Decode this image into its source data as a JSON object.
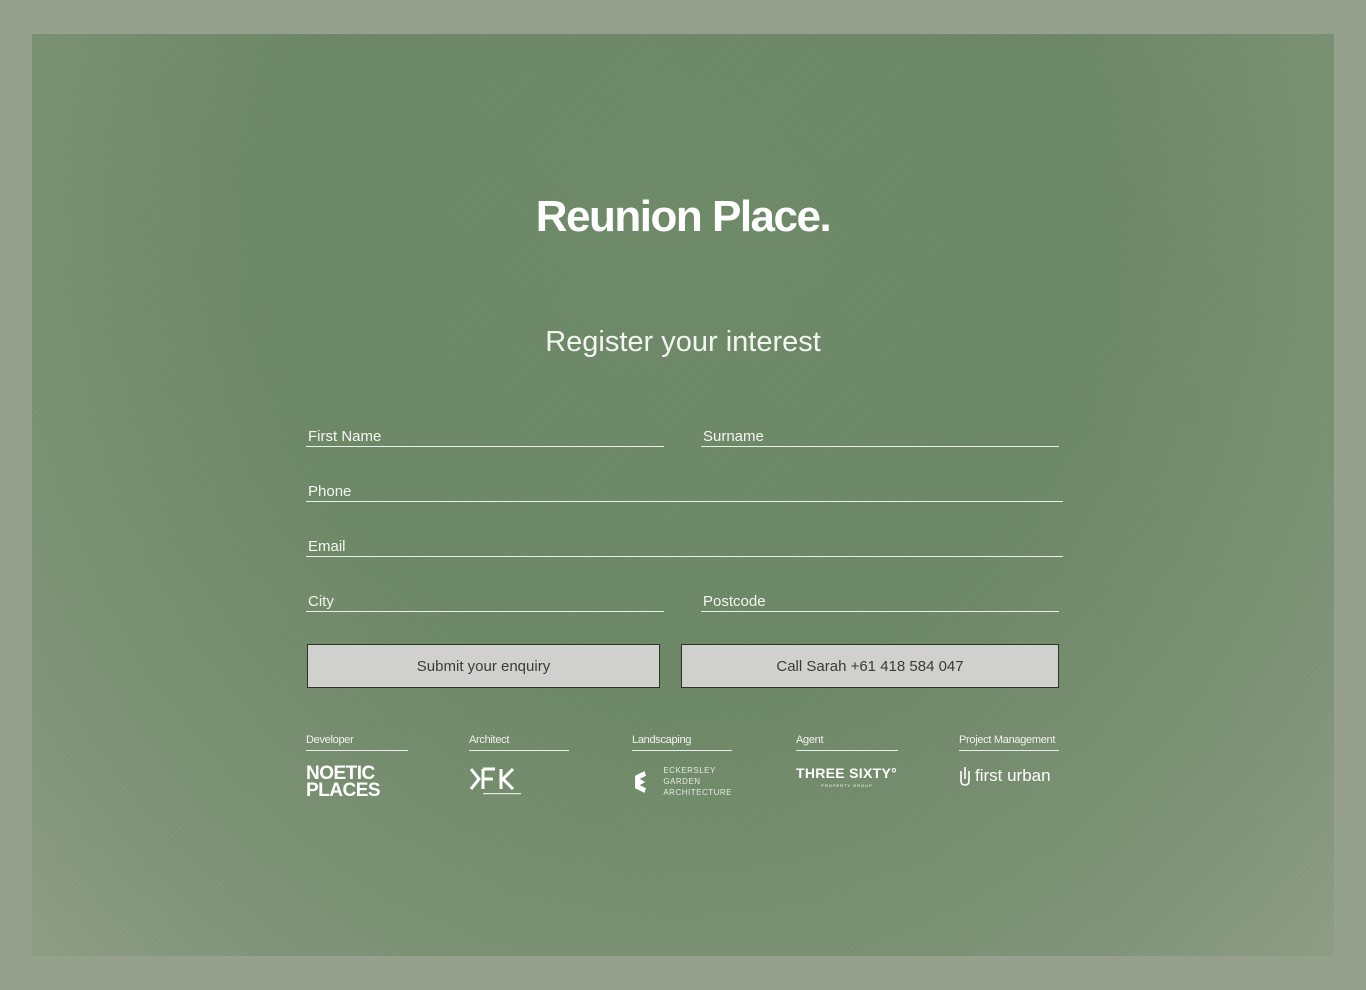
{
  "brand": {
    "title": "Reunion Place."
  },
  "form": {
    "heading": "Register your interest",
    "first_name_placeholder": "First Name",
    "surname_placeholder": "Surname",
    "phone_placeholder": "Phone",
    "email_placeholder": "Email",
    "city_placeholder": "City",
    "postcode_placeholder": "Postcode",
    "submit_label": "Submit your enquiry",
    "call_label": "Call Sarah +61 418 584 047"
  },
  "credits": [
    {
      "label": "Developer",
      "logo_text_line1": "NOETIC",
      "logo_text_line2": "PLACES",
      "icon": "noetic-places-logo"
    },
    {
      "label": "Architect",
      "logo_text": "FK",
      "icon": "fk-logo"
    },
    {
      "label": "Landscaping",
      "logo_text_line1": "ECKERSLEY",
      "logo_text_line2": "GARDEN",
      "logo_text_line3": "ARCHITECTURE",
      "icon": "eckersley-logo"
    },
    {
      "label": "Agent",
      "logo_text": "THREE SIXTY°",
      "logo_subtext": "PROPERTY GROUP",
      "icon": "three-sixty-logo"
    },
    {
      "label": "Project Management",
      "logo_text": "first urban",
      "icon": "first-urban-logo"
    }
  ],
  "colors": {
    "outer": "#95a08d",
    "panel": "#6e8a68",
    "button_bg": "#d0d0cf"
  }
}
